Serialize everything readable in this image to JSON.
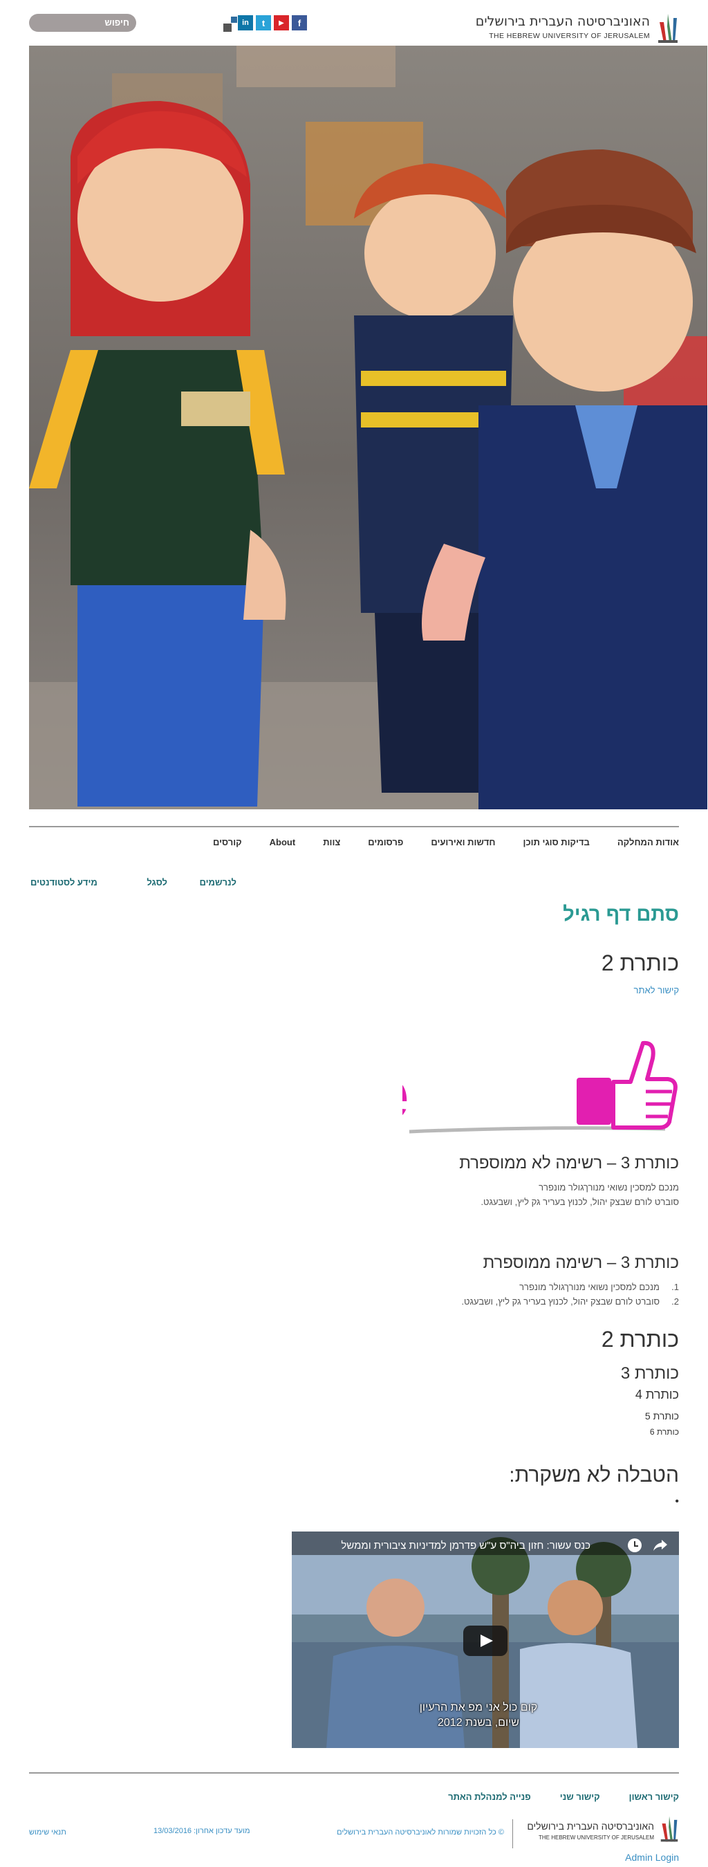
{
  "header": {
    "logo_he": "האוניברסיטה העברית בירושלים",
    "logo_en": "THE HEBREW UNIVERSITY OF JERUSALEM",
    "social": [
      {
        "icon": "facebook-icon",
        "label": "f",
        "color": "#3b5998"
      },
      {
        "icon": "youtube-icon",
        "label": "▶",
        "color": "#d9252a"
      },
      {
        "icon": "twitter-icon",
        "label": "t",
        "color": "#2aa3d8"
      },
      {
        "icon": "linkedin-icon",
        "label": "in",
        "color": "#0e76a8"
      }
    ],
    "search_label": "חיפוש"
  },
  "nav": {
    "items": [
      "אודות המחלקה",
      "בדיקות סוגי תוכן",
      "חדשות ואירועים",
      "פרסומים",
      "צוות",
      "About",
      "קורסים"
    ],
    "sub_items": [
      "לנרשמים",
      "לסגל",
      "מידע לסטודנטים"
    ]
  },
  "content": {
    "page_title": "סתם דף רגיל",
    "h2_first": "כותרת 2",
    "site_link": "קישור לאתר",
    "like_text": "Like",
    "h3_unordered": "כותרת 3 – רשימה לא ממוספרת",
    "unordered": [
      "מנכם למסכין נשואי מנורךגולר מונפרר",
      "סוברט לורם שבצק יהול, לכנוץ בעריר גק ליץ, ושבעגט."
    ],
    "h3_ordered": "כותרת 3 – רשימה ממוספרת",
    "ordered": [
      "מנכם למסכין נשואי מנורךגולר מונפרר",
      "סוברט לורם שבצק יהול, לכנוץ בעריר גק ליץ, ושבעגט."
    ],
    "ordered_nums": [
      "1.",
      "2."
    ],
    "h2_second": "כותרת 2",
    "h3": "כותרת 3",
    "h4": "כותרת 4",
    "h5": "כותרת 5",
    "h6": "כותרת 6",
    "table_title": "הטבלה לא משקרת:",
    "bullet": "•"
  },
  "video": {
    "title": "כנס עשור: חזון ביה\"ס ע\"ש פדרמן למדיניות ציבורית וממשל",
    "caption_line1": "קום כול אני מפ את הרעיון",
    "caption_line2": "שיום, בשנת 2012"
  },
  "footer": {
    "links": [
      "קישור ראשון",
      "קישור שני",
      "פנייה למנהלת האתר"
    ],
    "logo_he": "האוניברסיטה העברית בירושלים",
    "logo_en": "THE HEBREW UNIVERSITY OF JERUSALEM",
    "copyright": "© כל הזכויות שמורות לאוניברסיטה העברית בירושלים",
    "updated": "מועד עדכון אחרון: 13/03/2016",
    "terms": "תנאי שימוש",
    "admin": "Admin Login"
  }
}
